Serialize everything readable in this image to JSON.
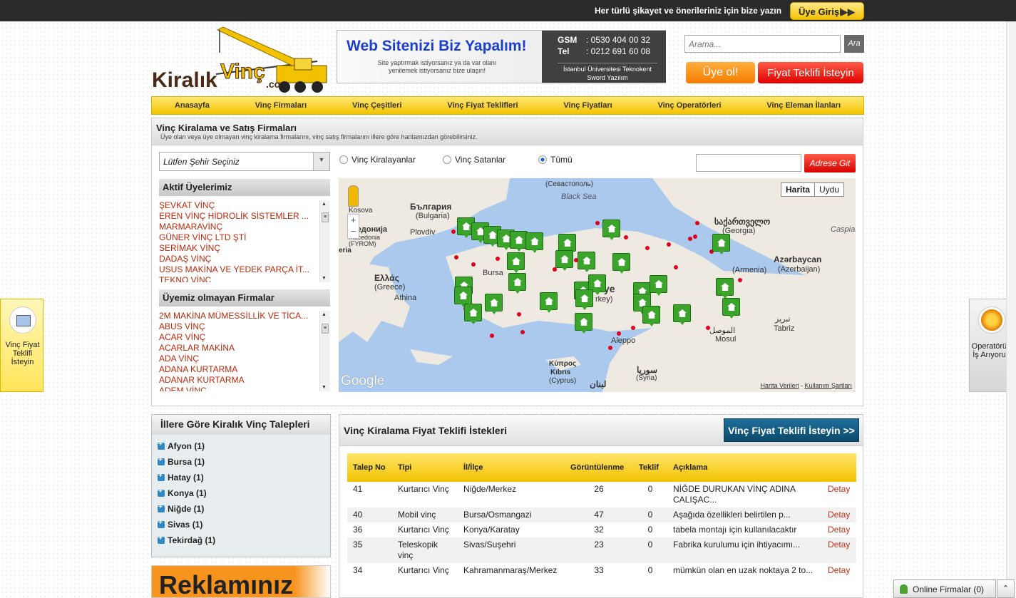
{
  "topbar": {
    "message": "Her türlü şikayet ve önerileriniz için bize yazın",
    "login_label": "Üye Girişi",
    "login_arrow": "▶▶"
  },
  "logo": {
    "word1": "Kiralık",
    "word2": "Vinç",
    "suffix": ".co"
  },
  "ad": {
    "title": "Web Sitenizi Biz Yapalım!",
    "subtitle": "Site yaptırmak istiyorsanız ya da var olanı yenilemek istiyorsanız bize ulaşın!",
    "gsm_label": "GSM",
    "gsm_value": ": 0530 404 00 32",
    "tel_label": "Tel",
    "tel_value": ": 0212 691 60 08",
    "footer": "İstanbul Üniversitesi Teknokent Sword Yazılım"
  },
  "search": {
    "placeholder": "Arama...",
    "button": "Ara"
  },
  "header_buttons": {
    "join": "Üye ol!",
    "quote": "Fiyat Teklifi İsteyin"
  },
  "nav": [
    "Anasayfa",
    "Vinç Firmaları",
    "Vinç Çeşitleri",
    "Vinç Fiyat Teklifleri",
    "Vinç Fiyatları",
    "Vinç Operatörleri",
    "Vinç Eleman İlanları"
  ],
  "main_panel": {
    "title": "Vinç Kiralama ve Satış Firmaları",
    "subtitle": "Üye olan veya üye olmayan vinç kiralama firmalarını, vinç satış firmalarını illere göre haritamızdan görebilirsiniz.",
    "city_select": "Lütfen Şehir Seçiniz",
    "radios": [
      {
        "label": "Vinç Kiralayanlar",
        "checked": false
      },
      {
        "label": "Vinç Satanlar",
        "checked": false
      },
      {
        "label": "Tümü",
        "checked": true
      }
    ],
    "address_button": "Adrese Git"
  },
  "active_members": {
    "title": "Aktif Üyelerimiz",
    "items": [
      "ŞEVKAT VİNÇ",
      "EREN VİNÇ HİDROLİK SİSTEMLER ...",
      "MARMARAVİNÇ",
      "GÜNER VİNÇ LTD ŞTİ",
      "SERİMAK VİNÇ",
      "DADAŞ VİNÇ",
      "USUS MAKİNA VE YEDEK PARÇA İT...",
      "TEKNO VİNÇ"
    ]
  },
  "non_members": {
    "title": "Üyemiz olmayan Firmalar",
    "items": [
      "2M MAKİNA MÜMESSİLLİK VE TİCA...",
      "ABUS VİNÇ",
      "ACAR VİNÇ",
      "ACARLAR MAKİNA",
      "ADA VİNÇ",
      "ADANA KURTARMA",
      "ADANAR KURTARMA",
      "ADEM VİNÇ"
    ]
  },
  "map": {
    "type_map": "Harita",
    "type_sat": "Uydu",
    "terms_data": "Harita Verileri",
    "terms_sep": " - ",
    "terms_use": "Kullanım Şartları",
    "google": "Google",
    "labels": {
      "bulgaria": "България",
      "bulgaria_en": "(Bulgaria)",
      "sevastopol": "(Севастополь)",
      "black_sea": "Black Sea",
      "kosova": "Kosova",
      "macedonia": "акедонија",
      "macedonia_en": "Macedonia",
      "fyrom": "(FYROM)",
      "plovdiv": "Plovdiv",
      "georgia": "საქართველო",
      "georgia_en": "(Georgia)",
      "caspian": "Caspian S",
      "azerbaycan": "Azərbaycan",
      "azerbaijan": "(Azerbaijan)",
      "armenia": "(Armenia)",
      "greece": "Ελλάς",
      "greece_en": "(Greece)",
      "athina": "Athina",
      "bursa": "Bursa",
      "turkey_a": "ye",
      "turkey_b": "rkey)",
      "tabriz": "Tabriz",
      "tabriz_fa": "تبریز",
      "aleppo": "Aleppo",
      "mosul_ar": "الموصل",
      "mosul": "Mosul",
      "cyprus": "Κύπρος",
      "kibris": "Kıbrıs",
      "cyprus_en": "(Cyprus)",
      "syria_ar": "سوريا",
      "syria": "(Syria)",
      "lebanon": "لبنان",
      "eria": "eria"
    }
  },
  "left_tab": {
    "label": "Vinç Fiyat Teklifi İsteyin"
  },
  "right_tab": {
    "label": "Operatörüm İş Arıyorum"
  },
  "requests": {
    "title": "İllere Göre Kiralık Vinç Talepleri",
    "cities": [
      "Afyon (1)",
      "Bursa (1)",
      "Hatay (1)",
      "Konya (1)",
      "Niğde (1)",
      "Sivas (1)",
      "Tekirdağ (1)"
    ]
  },
  "promo": {
    "text": "Reklamınız"
  },
  "quotes": {
    "title": "Vinç Kiralama Fiyat Teklifi İstekleri",
    "button": "Vinç Fiyat Teklifi İsteyin >>",
    "columns": [
      "Talep No",
      "Tipi",
      "İl/İlçe",
      "Görüntülenme",
      "Teklif",
      "Açıklama",
      ""
    ],
    "rows": [
      [
        "41",
        "Kurtarıcı Vinç",
        "Niğde/Merkez",
        "26",
        "0",
        "NİĞDE DURUKAN VİNÇ ADINA CALIŞAC...",
        "Detay"
      ],
      [
        "40",
        "Mobil vinç",
        "Bursa/Osmangazi",
        "47",
        "0",
        "Aşağıda özellikleri belirtilen p...",
        "Detay"
      ],
      [
        "36",
        "Kurtarıcı Vinç",
        "Konya/Karatay",
        "32",
        "0",
        "tabela montajı için kullanılacaktır",
        "Detay"
      ],
      [
        "35",
        "Teleskopik vinç",
        "Sivas/Suşehri",
        "23",
        "0",
        "Fabrika kurulumu için ihtiyacımı...",
        "Detay"
      ],
      [
        "34",
        "Kurtarıcı Vinç",
        "Kahramanmaraş/Merkez",
        "33",
        "0",
        "mümkün olan en uzak noktaya 2 to...",
        "Detay"
      ]
    ]
  },
  "online": {
    "label": "Online Firmalar (0)",
    "toggle": "⌃"
  }
}
